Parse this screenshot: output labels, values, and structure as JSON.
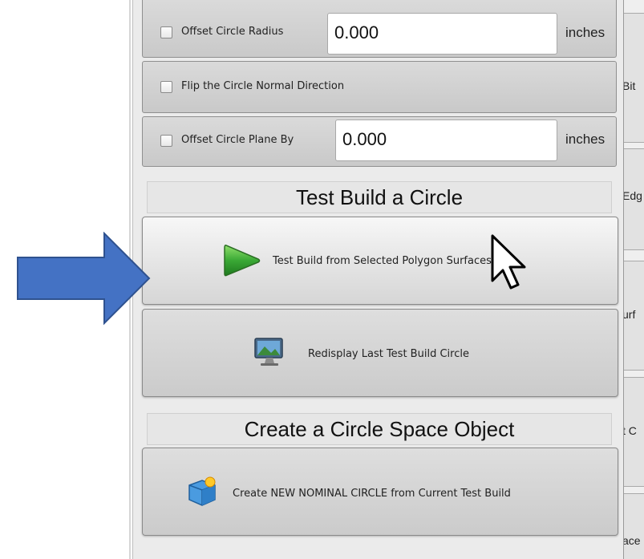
{
  "options": {
    "offset_radius": {
      "label": "Offset Circle Radius",
      "value": "0.000",
      "unit": "inches",
      "checked": false
    },
    "flip_normal": {
      "label": "Flip the Circle Normal Direction",
      "checked": false
    },
    "offset_plane": {
      "label": "Offset Circle Plane By",
      "value": "0.000",
      "unit": "inches",
      "checked": false
    }
  },
  "test_build": {
    "heading": "Test Build a Circle",
    "test_button_label": "Test Build from Selected Polygon Surfaces",
    "redisplay_button_label": "Redisplay Last Test Build Circle"
  },
  "create": {
    "heading": "Create a Circle Space Object",
    "create_button_label": "Create NEW NOMINAL CIRCLE from Current Test Build"
  },
  "right_tabs": [
    "Bit",
    "Edg",
    "urf",
    "t C",
    "ace"
  ],
  "colors": {
    "arrow": "#4472c4",
    "play_icon": "#3aa835",
    "panel_bg": "#ebebeb"
  }
}
